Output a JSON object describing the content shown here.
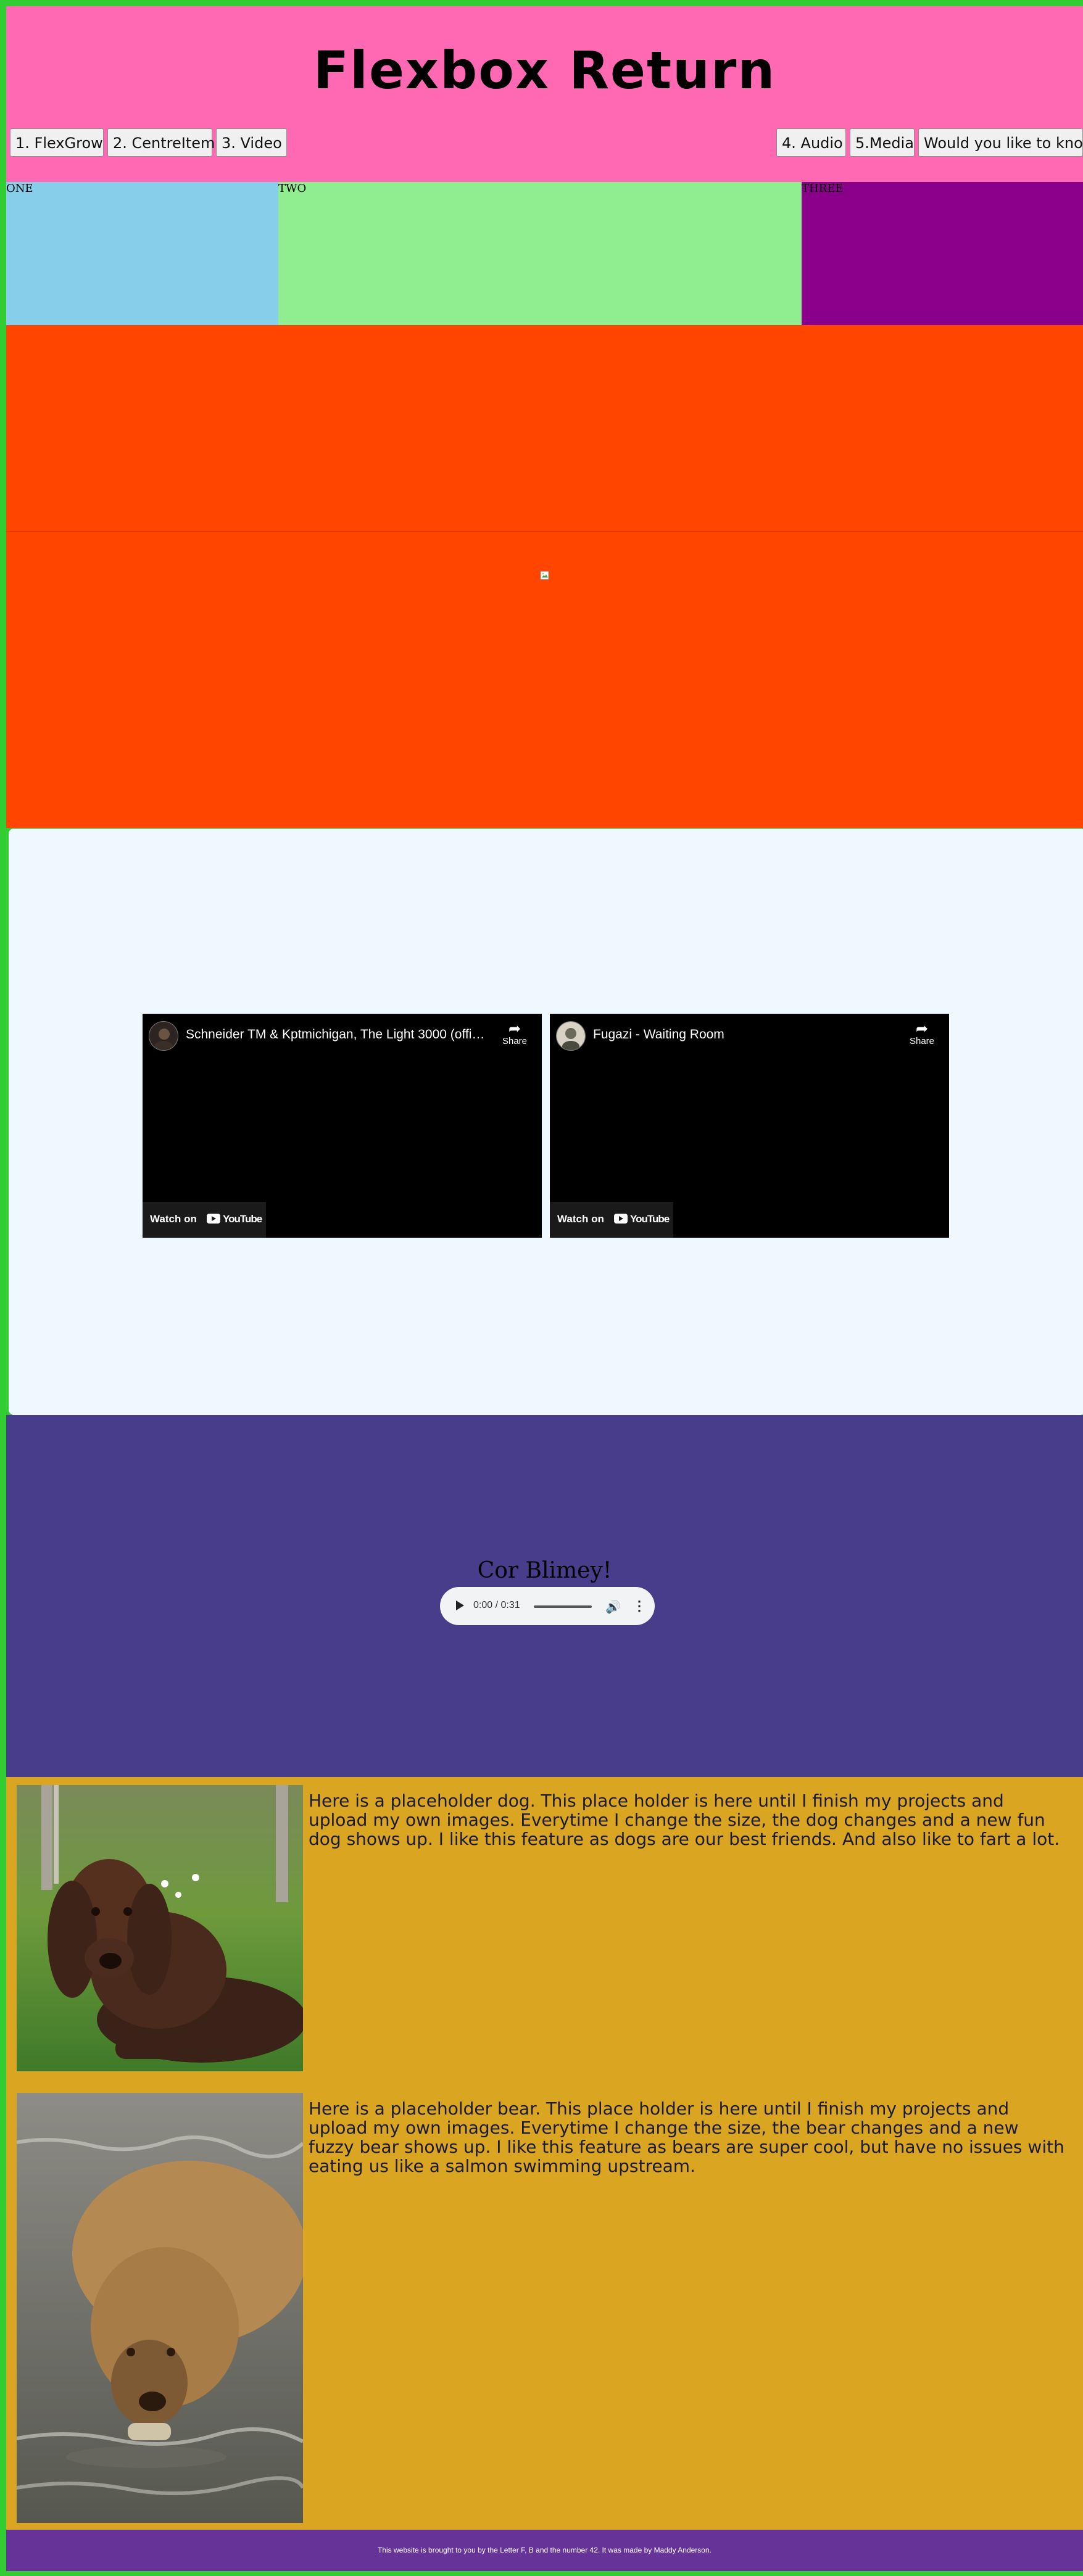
{
  "header": {
    "title": "Flexbox Return",
    "nav_left": [
      "1. FlexGrow",
      "2. CentreItem",
      "3. Video"
    ],
    "nav_right": [
      "4. Audio",
      "5.Media",
      "Would you like to know"
    ]
  },
  "flexgrow": {
    "cells": [
      {
        "label": "ONE",
        "color": "#87ceeb"
      },
      {
        "label": "TWO",
        "color": "#90ee90"
      },
      {
        "label": "THREE",
        "color": "#8b008b"
      }
    ]
  },
  "videos": [
    {
      "title": "Schneider TM & Kptmichigan, The Light 3000 (offic...",
      "share": "Share",
      "watch": "Watch on",
      "brand": "YouTube"
    },
    {
      "title": "Fugazi - Waiting Room",
      "share": "Share",
      "watch": "Watch on",
      "brand": "YouTube"
    }
  ],
  "audio": {
    "title": "Cor Blimey!",
    "time": "0:00 / 0:31"
  },
  "media": {
    "dog_text": "Here is a placeholder dog. This place holder is here until I finish my projects and upload my own images. Everytime I change the size, the dog changes and a new fun dog shows up. I like this feature as dogs are our best friends. And also like to fart a lot.",
    "bear_text": "Here is a placeholder bear. This place holder is here until I finish my projects and upload my own images. Everytime I change the size, the bear changes and a new fuzzy bear shows up. I like this feature as bears are super cool, but have no issues with eating us like a salmon swimming upstream."
  },
  "footer": {
    "text": "This website is brought to you by the Letter F, B and the number 42. It was made by Maddy Anderson."
  },
  "colors": {
    "page_border": "#32cd32",
    "header": "#ff69b4",
    "centre": "#ff4500",
    "video_bg": "#f0f8ff",
    "audio_bg": "#483d8b",
    "media_bg": "#daa520",
    "footer_bg": "#663399"
  }
}
